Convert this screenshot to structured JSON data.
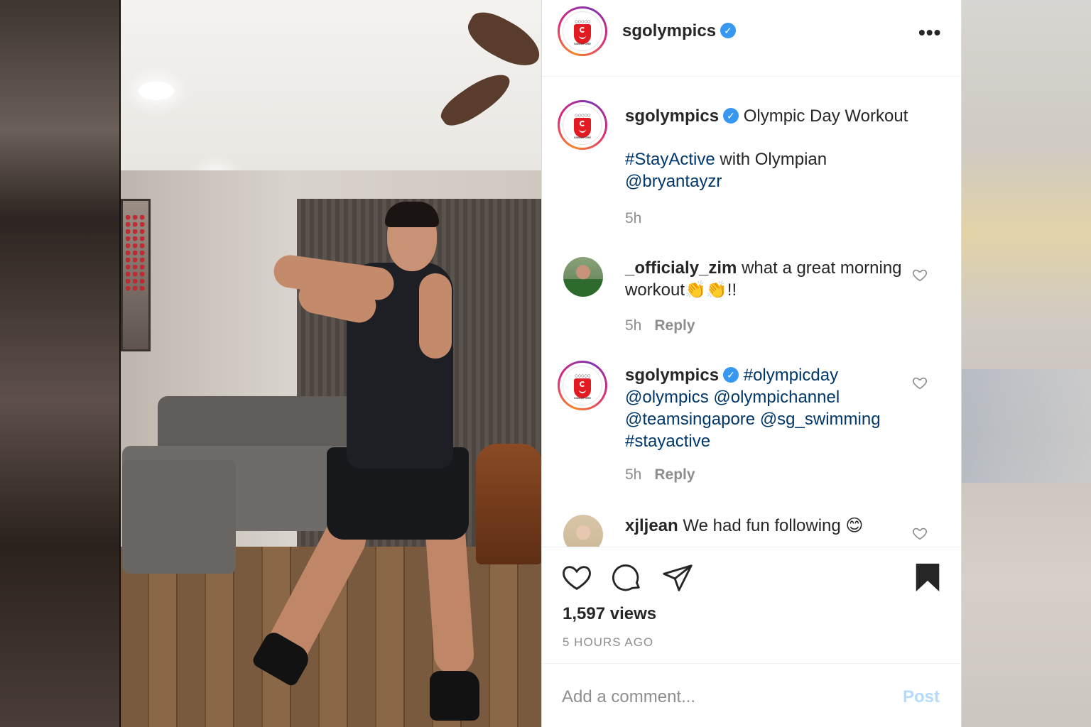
{
  "header": {
    "username": "sgolympics",
    "verified_icon": "verified-badge-icon",
    "more_icon": "ellipsis-icon"
  },
  "logo": {
    "rings": "○○○○○",
    "caption": "SINGAPORE"
  },
  "caption": {
    "username": "sgolympics",
    "title": "Olympic Day Workout",
    "hashtag": "#StayActive",
    "text_mid": " with Olympian",
    "mention": "@bryantayzr",
    "time": "5h"
  },
  "comments": [
    {
      "username": "_officialy_zim",
      "text": " what a great morning workout👏👏!!",
      "time": "5h",
      "reply": "Reply"
    },
    {
      "username": "sgolympics",
      "tags": [
        "#olympicday",
        "@olympics",
        "@olympichannel",
        "@teamsingapore",
        "@sg_swimming",
        "#stayactive"
      ],
      "time": "5h",
      "reply": "Reply"
    },
    {
      "username": "xjljean",
      "text": " We had fun following 😊"
    }
  ],
  "actions": {
    "views": "1,597 views",
    "time_ago": "5 HOURS AGO"
  },
  "add_comment": {
    "placeholder": "Add a comment...",
    "post_label": "Post"
  },
  "colors": {
    "link": "#00376b",
    "verified": "#3897f0",
    "muted": "#8e8e8e",
    "post_disabled": "#b3dbff"
  }
}
